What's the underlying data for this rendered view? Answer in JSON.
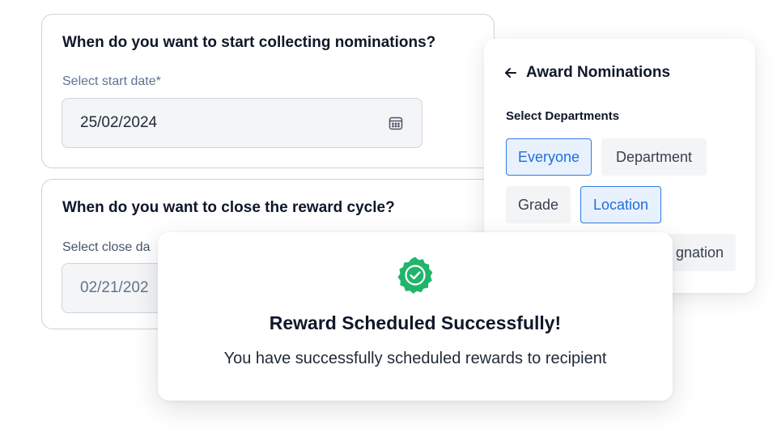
{
  "start_section": {
    "question": "When do you want to start collecting nominations?",
    "field_label": "Select start date*",
    "value": "25/02/2024"
  },
  "close_section": {
    "question": "When do you want to close the reward cycle?",
    "field_label": "Select close da",
    "value": "02/21/202"
  },
  "departments_panel": {
    "title": "Award Nominations",
    "section_label": "Select Departments",
    "chips": [
      {
        "label": "Everyone",
        "selected": true
      },
      {
        "label": "Department",
        "selected": false
      },
      {
        "label": "Grade",
        "selected": false
      },
      {
        "label": "Location",
        "selected": true
      },
      {
        "label": "gnation",
        "selected": false
      }
    ]
  },
  "success_modal": {
    "title": "Reward Scheduled Successfully!",
    "message": "You have successfully scheduled rewards to recipient"
  },
  "colors": {
    "accent": "#2f7be3",
    "success": "#1fb56b",
    "label_blue_gray": "#5f7493",
    "label_dark_gray": "#475569"
  },
  "icons": [
    "calendar-icon",
    "back-arrow-icon",
    "success-check-badge-icon"
  ]
}
